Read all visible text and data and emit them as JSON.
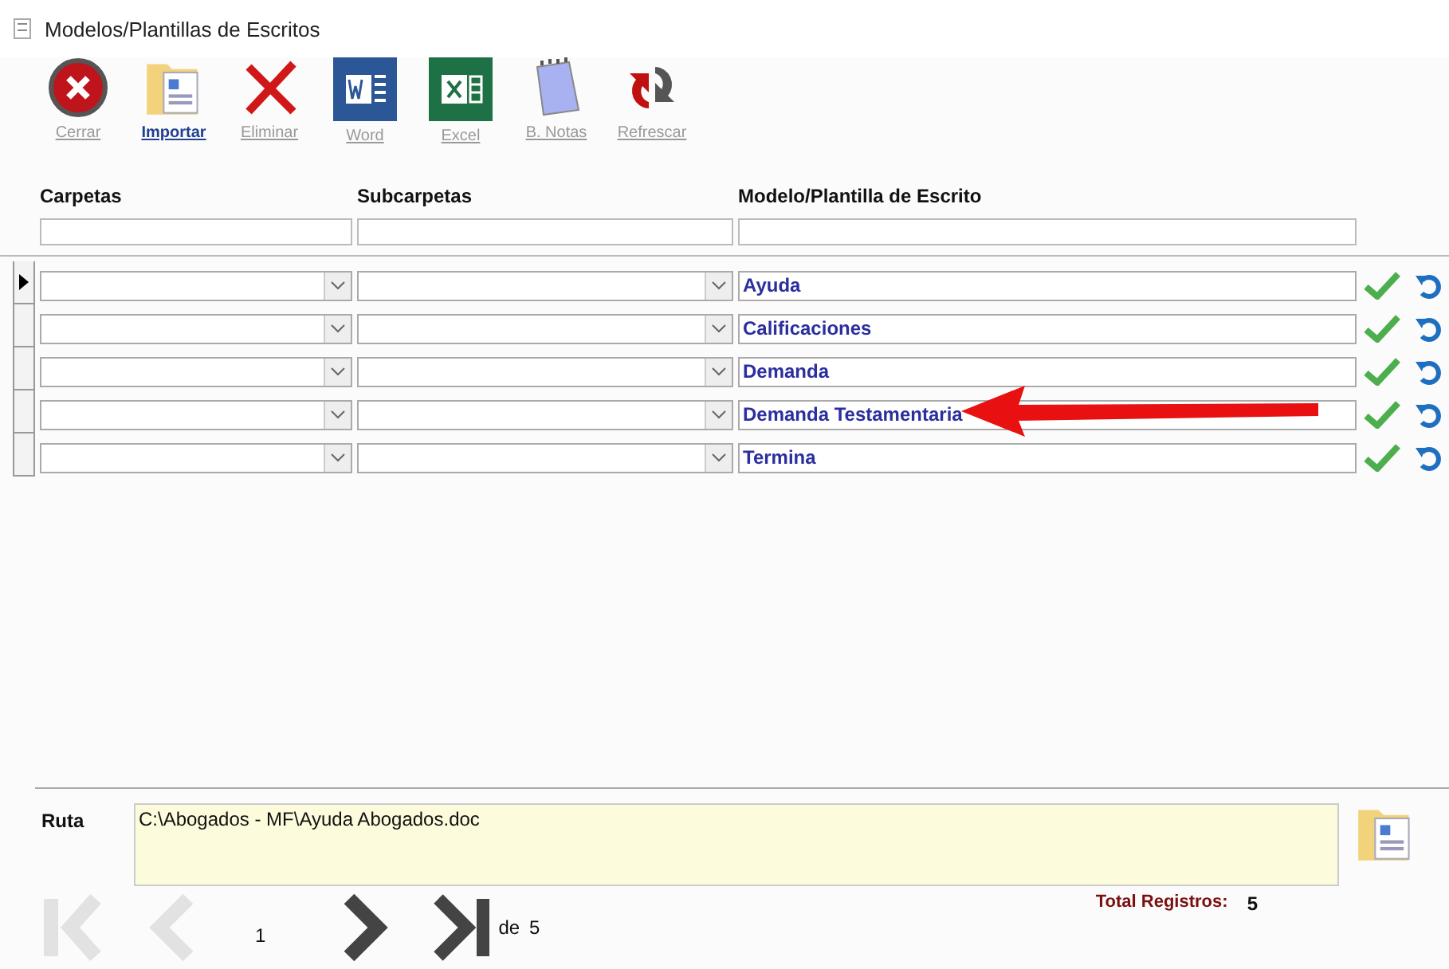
{
  "window": {
    "title": "Modelos/Plantillas de Escritos"
  },
  "toolbar": [
    {
      "kind": "close",
      "label": "Cerrar",
      "disabled": true
    },
    {
      "kind": "import",
      "label": "Importar",
      "disabled": false
    },
    {
      "kind": "delete",
      "label": "Eliminar",
      "disabled": true
    },
    {
      "kind": "word",
      "label": "Word",
      "disabled": true
    },
    {
      "kind": "excel",
      "label": "Excel",
      "disabled": true
    },
    {
      "kind": "notes",
      "label": "B. Notas",
      "disabled": true
    },
    {
      "kind": "refresh",
      "label": "Refrescar",
      "disabled": true
    }
  ],
  "columns": [
    "Carpetas",
    "Subcarpetas",
    "Modelo/Plantilla de Escrito"
  ],
  "rows": [
    {
      "template": "Ayuda",
      "selected": true,
      "annotated": false
    },
    {
      "template": "Calificaciones",
      "selected": false,
      "annotated": false
    },
    {
      "template": "Demanda",
      "selected": false,
      "annotated": false
    },
    {
      "template": "Demanda Testamentaria",
      "selected": false,
      "annotated": true
    },
    {
      "template": "Termina",
      "selected": false,
      "annotated": false
    }
  ],
  "path": {
    "label": "Ruta",
    "value": "C:\\Abogados - MF\\Ayuda Abogados.doc"
  },
  "pager": {
    "first_disabled": true,
    "prev_disabled": true,
    "current": "1",
    "of_label": "de",
    "pages": "5"
  },
  "total": {
    "label": "Total Registros:",
    "value": "5"
  }
}
